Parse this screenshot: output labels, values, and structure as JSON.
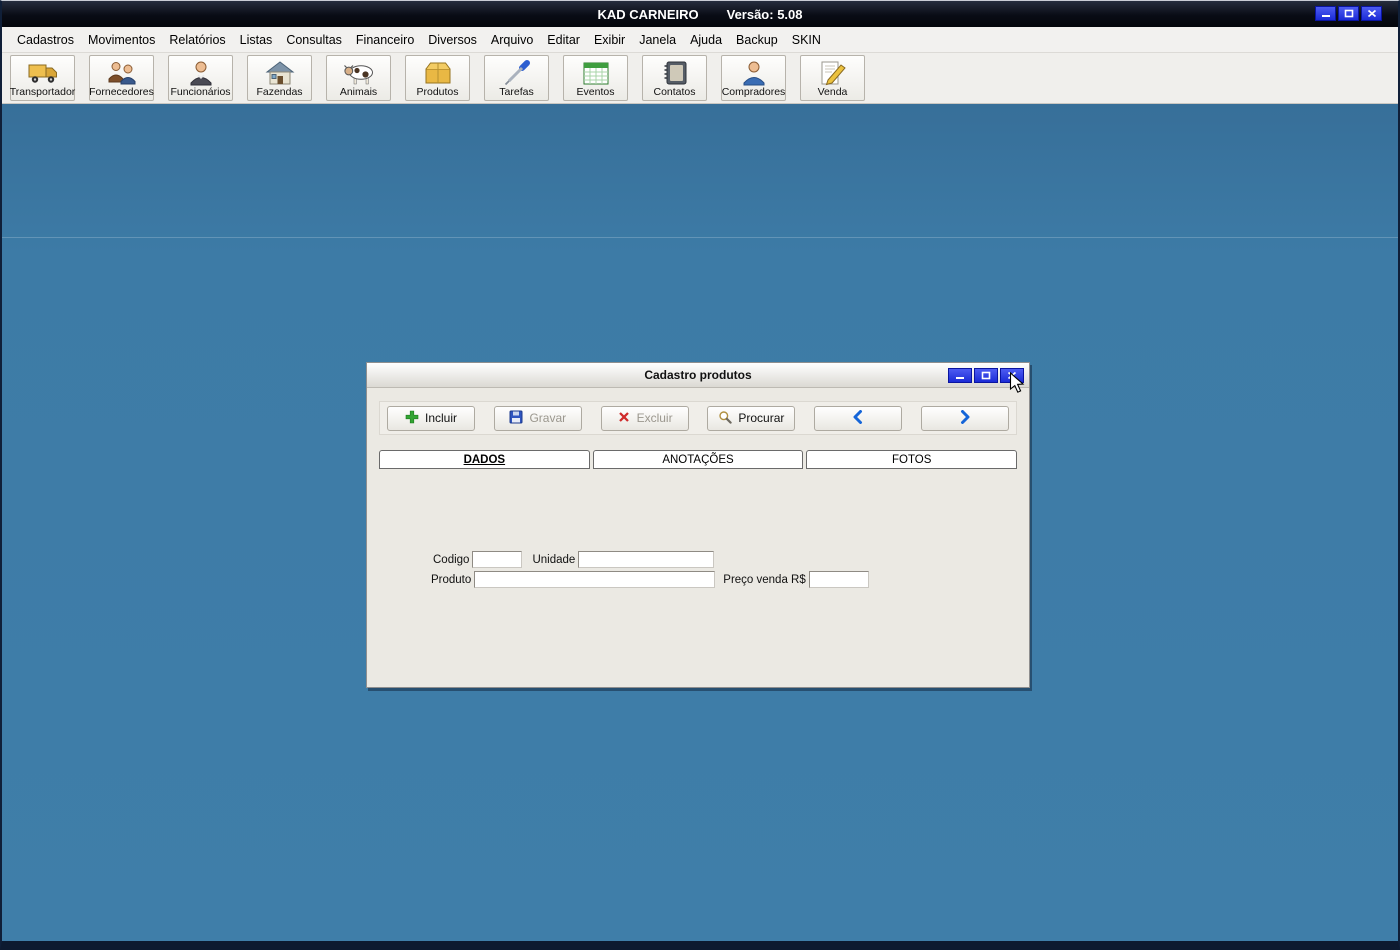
{
  "titlebar": {
    "app_title": "KAD CARNEIRO",
    "version": "Versão: 5.08"
  },
  "menu": {
    "items": [
      "Cadastros",
      "Movimentos",
      "Relatórios",
      "Listas",
      "Consultas",
      "Financeiro",
      "Diversos",
      "Arquivo",
      "Editar",
      "Exibir",
      "Janela",
      "Ajuda",
      "Backup",
      "SKIN"
    ]
  },
  "toolbar": {
    "buttons": [
      {
        "label": "Transportador",
        "icon": "truck-icon"
      },
      {
        "label": "Fornecedores",
        "icon": "suppliers-icon"
      },
      {
        "label": "Funcionários",
        "icon": "employee-icon"
      },
      {
        "label": "Fazendas",
        "icon": "farm-house-icon"
      },
      {
        "label": "Animais",
        "icon": "cow-icon"
      },
      {
        "label": "Produtos",
        "icon": "box-icon"
      },
      {
        "label": "Tarefas",
        "icon": "screwdriver-icon"
      },
      {
        "label": "Eventos",
        "icon": "calendar-icon"
      },
      {
        "label": "Contatos",
        "icon": "address-book-icon"
      },
      {
        "label": "Compradores",
        "icon": "buyer-person-icon"
      },
      {
        "label": "Venda",
        "icon": "pencil-sale-icon"
      }
    ]
  },
  "dialog": {
    "title": "Cadastro produtos",
    "buttons": {
      "incluir": "Incluir",
      "gravar": "Gravar",
      "excluir": "Excluir",
      "procurar": "Procurar"
    },
    "tabs": [
      {
        "label": "DADOS",
        "selected": true
      },
      {
        "label": "ANOTAÇÕES",
        "selected": false
      },
      {
        "label": "FOTOS",
        "selected": false
      }
    ],
    "fields": [
      {
        "label": "Codigo",
        "value": ""
      },
      {
        "label": "Unidade",
        "value": ""
      },
      {
        "label": "Produto",
        "value": ""
      },
      {
        "label": "Preço venda R$",
        "value": ""
      }
    ]
  },
  "colors": {
    "desktop_blue": "#3f7ea9",
    "button_blue": "#1b2bd6",
    "disabled_text": "#9b978e"
  }
}
